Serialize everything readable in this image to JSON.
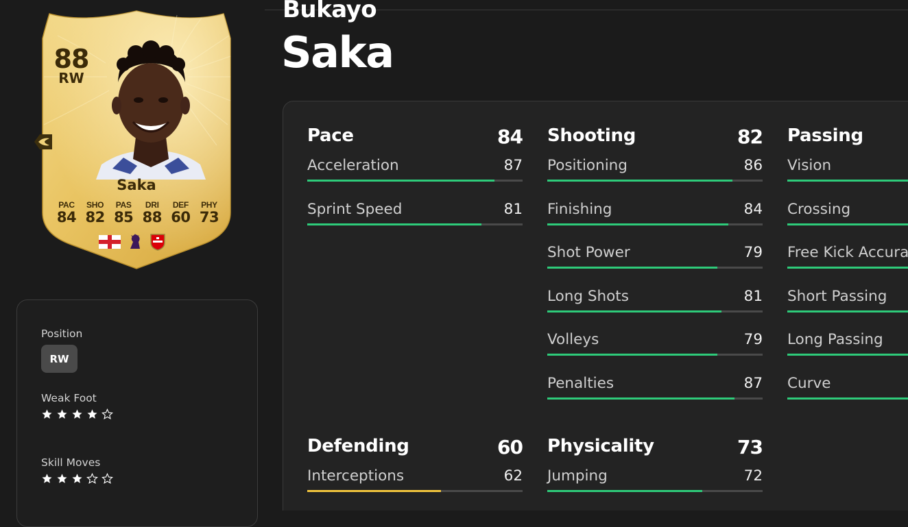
{
  "card": {
    "rating": "88",
    "position": "RW",
    "name": "Saka",
    "stats": [
      {
        "label": "PAC",
        "value": "84"
      },
      {
        "label": "SHO",
        "value": "82"
      },
      {
        "label": "PAS",
        "value": "85"
      },
      {
        "label": "DRI",
        "value": "88"
      },
      {
        "label": "DEF",
        "value": "60"
      },
      {
        "label": "PHY",
        "value": "73"
      }
    ],
    "nation_icon": "england-flag-icon",
    "league_icon": "premier-league-icon",
    "club_icon": "arsenal-crest-icon",
    "colors": {
      "gold": "#e8c25a",
      "text": "#3b2a08"
    }
  },
  "info": {
    "position_label": "Position",
    "position_value": "RW",
    "weak_foot_label": "Weak Foot",
    "weak_foot_stars": 4,
    "skill_moves_label": "Skill Moves",
    "skill_moves_stars": 3,
    "max_stars": 5
  },
  "player": {
    "first_name": "Bukayo",
    "last_name": "Saka"
  },
  "colors": {
    "high": "#2ecb7a",
    "mid": "#f2c53d",
    "track": "#4a4a4a"
  },
  "groups": [
    {
      "name": "Pace",
      "value": "84",
      "attrs": [
        {
          "name": "Acceleration",
          "value": 87
        },
        {
          "name": "Sprint Speed",
          "value": 81
        }
      ]
    },
    {
      "name": "Shooting",
      "value": "82",
      "attrs": [
        {
          "name": "Positioning",
          "value": 86
        },
        {
          "name": "Finishing",
          "value": 84
        },
        {
          "name": "Shot Power",
          "value": 79
        },
        {
          "name": "Long Shots",
          "value": 81
        },
        {
          "name": "Volleys",
          "value": 79
        },
        {
          "name": "Penalties",
          "value": 87
        }
      ]
    },
    {
      "name": "Passing",
      "value": "",
      "attrs": [
        {
          "name": "Vision",
          "value": null
        },
        {
          "name": "Crossing",
          "value": null
        },
        {
          "name": "Free Kick Accura",
          "value": null
        },
        {
          "name": "Short Passing",
          "value": null
        },
        {
          "name": "Long Passing",
          "value": null
        },
        {
          "name": "Curve",
          "value": null
        }
      ]
    },
    {
      "name": "Defending",
      "value": "60",
      "attrs": [
        {
          "name": "Interceptions",
          "value": 62
        }
      ]
    },
    {
      "name": "Physicality",
      "value": "73",
      "attrs": [
        {
          "name": "Jumping",
          "value": 72
        }
      ]
    }
  ]
}
